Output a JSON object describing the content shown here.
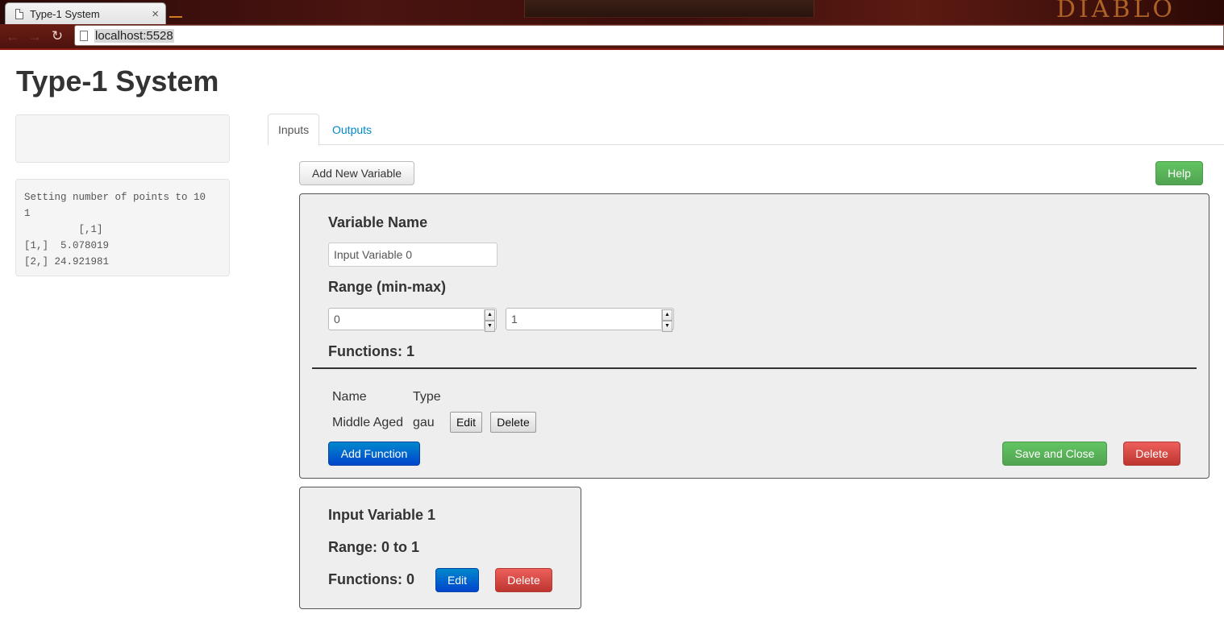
{
  "browser": {
    "tab_title": "Type-1 System",
    "tab_close": "×",
    "url": "localhost:5528",
    "back": "←",
    "forward": "→",
    "reload": "↻"
  },
  "page": {
    "title": "Type-1 System",
    "console_output": "Setting number of points to 10\n1\n         [,1]\n[1,]  5.078019\n[2,] 24.921981"
  },
  "tabs": [
    {
      "label": "Inputs",
      "active": true
    },
    {
      "label": "Outputs",
      "active": false
    }
  ],
  "toolbar": {
    "add_variable_label": "Add New Variable",
    "help_label": "Help"
  },
  "editor": {
    "variable_name_label": "Variable Name",
    "variable_name_value": "Input Variable 0",
    "range_label": "Range (min-max)",
    "range_min": "0",
    "range_max": "1",
    "functions_label": "Functions: 1",
    "columns": [
      "Name",
      "Type"
    ],
    "functions": [
      {
        "name": "Middle Aged",
        "type": "gau",
        "edit_label": "Edit",
        "delete_label": "Delete"
      }
    ],
    "add_function_label": "Add Function",
    "save_close_label": "Save and Close",
    "delete_label": "Delete"
  },
  "variables": [
    {
      "name": "Input Variable 1",
      "range_text": "Range: 0 to 1",
      "functions_text": "Functions: 0",
      "edit_label": "Edit",
      "delete_label": "Delete"
    }
  ],
  "colors": {
    "primary": "#0088cc",
    "success": "#51a351",
    "danger": "#bd362f",
    "link": "#0088cc"
  }
}
